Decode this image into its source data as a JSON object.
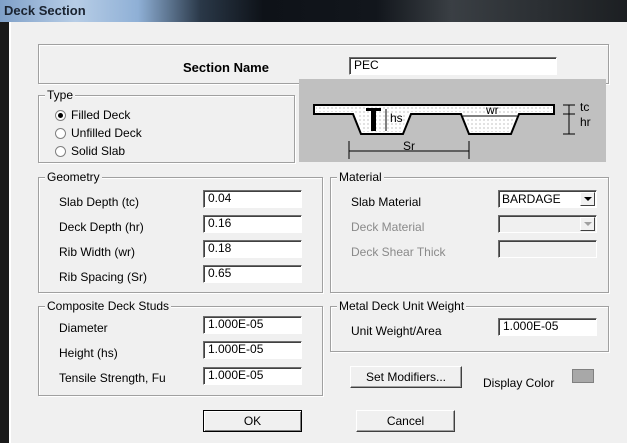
{
  "window": {
    "title": "Deck Section"
  },
  "section": {
    "name_label": "Section Name",
    "name_value": "PEC"
  },
  "type": {
    "legend": "Type",
    "options": [
      {
        "label": "Filled Deck",
        "selected": true
      },
      {
        "label": "Unfilled Deck",
        "selected": false
      },
      {
        "label": "Solid Slab",
        "selected": false
      }
    ]
  },
  "diagram": {
    "hs": "hs",
    "wr": "wr",
    "sr": "Sr",
    "tc": "tc",
    "hr": "hr"
  },
  "geometry": {
    "legend": "Geometry",
    "slab_depth_label": "Slab Depth (tc)",
    "slab_depth_value": "0.04",
    "deck_depth_label": "Deck Depth (hr)",
    "deck_depth_value": "0.16",
    "rib_width_label": "Rib Width (wr)",
    "rib_width_value": "0.18",
    "rib_spacing_label": "Rib Spacing (Sr)",
    "rib_spacing_value": "0.65"
  },
  "material": {
    "legend": "Material",
    "slab_material_label": "Slab Material",
    "slab_material_value": "BARDAGE",
    "deck_material_label": "Deck Material",
    "deck_material_value": "",
    "deck_shear_label": "Deck Shear Thick",
    "deck_shear_value": ""
  },
  "studs": {
    "legend": "Composite Deck Studs",
    "diameter_label": "Diameter",
    "diameter_value": "1.000E-05",
    "height_label": "Height (hs)",
    "height_value": "1.000E-05",
    "fu_label": "Tensile Strength, Fu",
    "fu_value": "1.000E-05"
  },
  "unit_weight": {
    "legend": "Metal Deck Unit Weight",
    "label": "Unit Weight/Area",
    "value": "1.000E-05"
  },
  "buttons": {
    "set_modifiers": "Set Modifiers...",
    "display_color_label": "Display Color",
    "display_color": "#a8a8a8",
    "ok": "OK",
    "cancel": "Cancel"
  }
}
